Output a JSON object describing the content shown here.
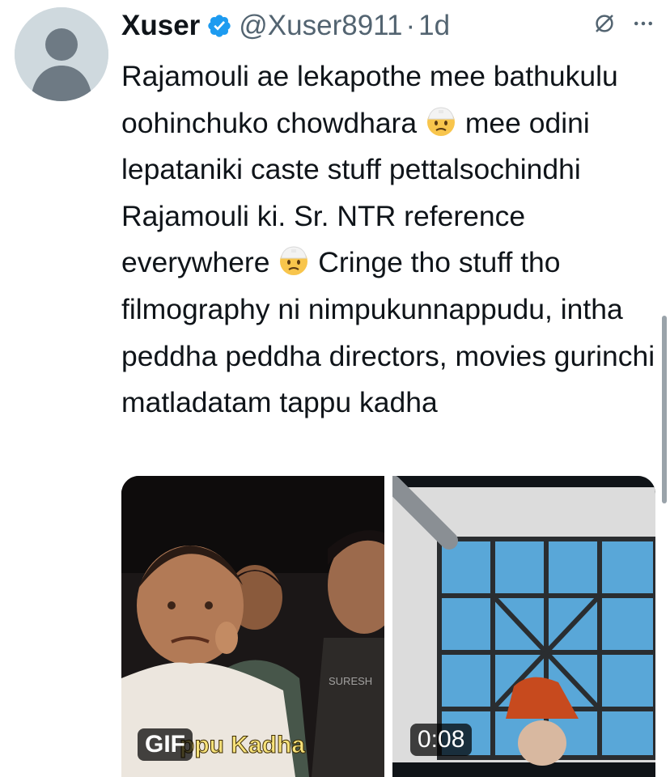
{
  "tweet": {
    "author_name": "Xuser",
    "handle": "@Xuser8911",
    "separator": "·",
    "time": "1d",
    "text_segments": [
      "Rajamouli ae lekapothe mee bathukulu oohinchuko chowdhara ",
      " mee odini lepataniki caste stuff pettalsochindhi Rajamouli ki. Sr. NTR reference everywhere ",
      " Cringe tho stuff tho filmography ni nimpukunnappudu, intha peddha peddha directors, movies gurinchi matladatam tappu kadha"
    ],
    "emoji_name": "face-with-head-bandage-emoji"
  },
  "media": [
    {
      "type": "gif",
      "badge": "GIF",
      "caption": "ppu Kadha",
      "watermark": "SURESH"
    },
    {
      "type": "video",
      "badge": "0:08"
    }
  ],
  "colors": {
    "verified": "#1d9bf0",
    "secondary_text": "#536471",
    "primary_text": "#0f1419"
  }
}
